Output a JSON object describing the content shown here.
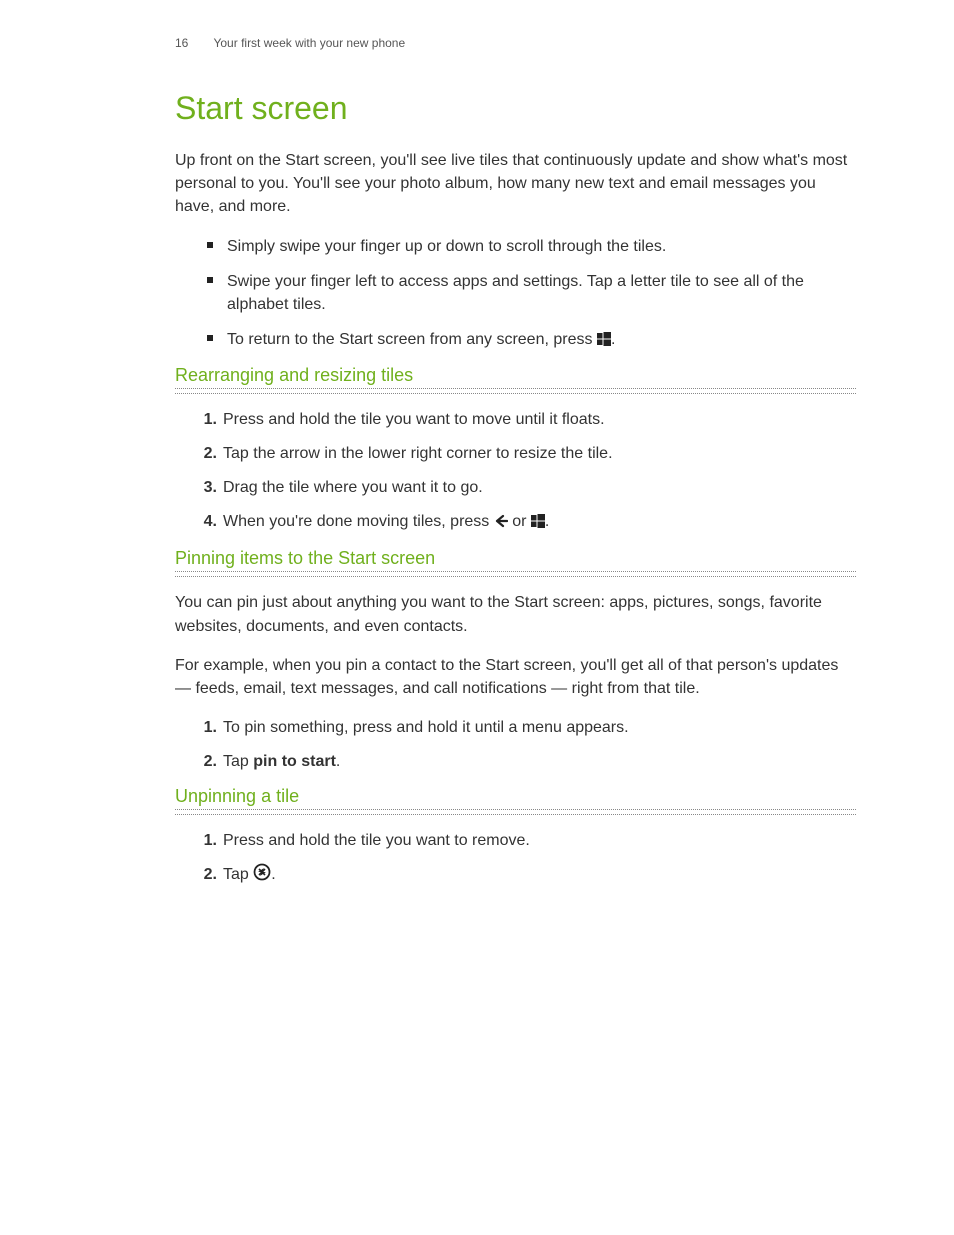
{
  "header": {
    "page_number": "16",
    "running_title": "Your first week with your new phone"
  },
  "title": "Start screen",
  "intro": "Up front on the Start screen, you'll see live tiles that continuously update and show what's most personal to you. You'll see your photo album, how many new text and email messages you have, and more.",
  "bullets": {
    "b1": "Simply swipe your finger up or down to scroll through the tiles.",
    "b2": "Swipe your finger left to access apps and settings. Tap a letter tile to see all of the alphabet tiles.",
    "b3_pre": "To return to the Start screen from any screen, press ",
    "b3_post": "."
  },
  "section1": {
    "heading": "Rearranging and resizing tiles",
    "s1": "Press and hold the tile you want to move until it floats.",
    "s2": "Tap the arrow in the lower right corner to resize the tile.",
    "s3": "Drag the tile where you want it to go.",
    "s4_pre": "When you're done moving tiles, press ",
    "s4_mid": " or ",
    "s4_post": "."
  },
  "section2": {
    "heading": "Pinning items to the Start screen",
    "p1": "You can pin just about anything you want to the Start screen: apps, pictures, songs, favorite websites, documents, and even contacts.",
    "p2": "For example, when you pin a contact to the Start screen, you'll get all of that person's updates — feeds, email, text messages, and call notifications — right from that tile.",
    "s1": "To pin something, press and hold it until a menu appears.",
    "s2_pre": "Tap ",
    "s2_bold": "pin to start",
    "s2_post": "."
  },
  "section3": {
    "heading": "Unpinning a tile",
    "s1": "Press and hold the tile you want to remove.",
    "s2_pre": "Tap ",
    "s2_post": "."
  },
  "icons": {
    "windows": "windows-logo-icon",
    "back_arrow": "back-arrow-icon",
    "unpin": "unpin-circle-icon"
  }
}
